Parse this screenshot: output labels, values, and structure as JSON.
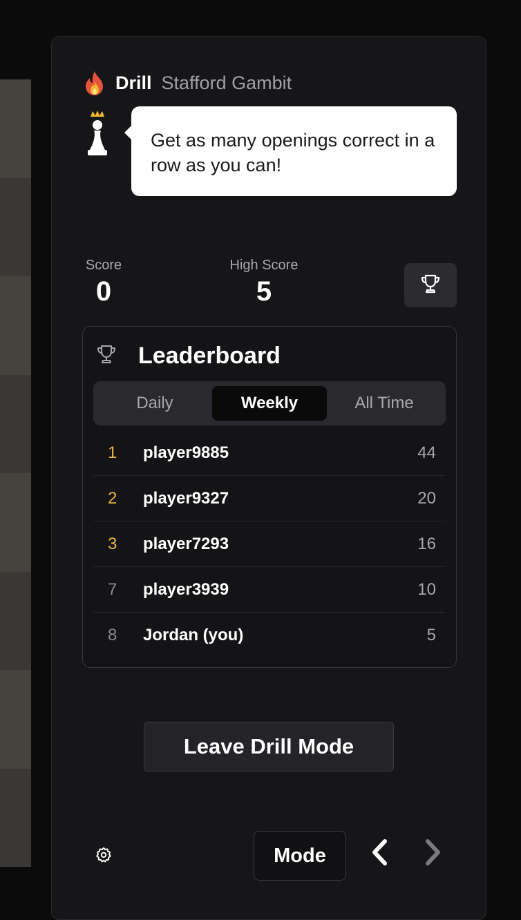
{
  "header": {
    "mode_label": "Drill",
    "opening_name": "Stafford Gambit"
  },
  "coach": {
    "message": "Get as many openings correct in a row as you can!"
  },
  "stats": {
    "score_label": "Score",
    "score_value": "0",
    "high_score_label": "High Score",
    "high_score_value": "5"
  },
  "leaderboard": {
    "title": "Leaderboard",
    "tabs": [
      {
        "label": "Daily",
        "active": false
      },
      {
        "label": "Weekly",
        "active": true
      },
      {
        "label": "All Time",
        "active": false
      }
    ],
    "rows": [
      {
        "rank": "1",
        "name": "player9885",
        "score": "44"
      },
      {
        "rank": "2",
        "name": "player9327",
        "score": "20"
      },
      {
        "rank": "3",
        "name": "player7293",
        "score": "16"
      },
      {
        "rank": "7",
        "name": "player3939",
        "score": "10"
      },
      {
        "rank": "8",
        "name": "Jordan (you)",
        "score": "5"
      }
    ]
  },
  "actions": {
    "leave_label": "Leave Drill Mode",
    "mode_label": "Mode"
  },
  "icons": {
    "fire": "fire-icon",
    "pawn": "crowned-pawn-icon",
    "trophy": "trophy-icon",
    "settings": "gear-icon",
    "prev": "chevron-left-icon",
    "next": "chevron-right-icon"
  },
  "colors": {
    "panel_bg": "#161618",
    "top_rank": "#e7b53b",
    "muted_text": "#a7a7ad",
    "active_tab_bg": "#0a0a0b"
  }
}
